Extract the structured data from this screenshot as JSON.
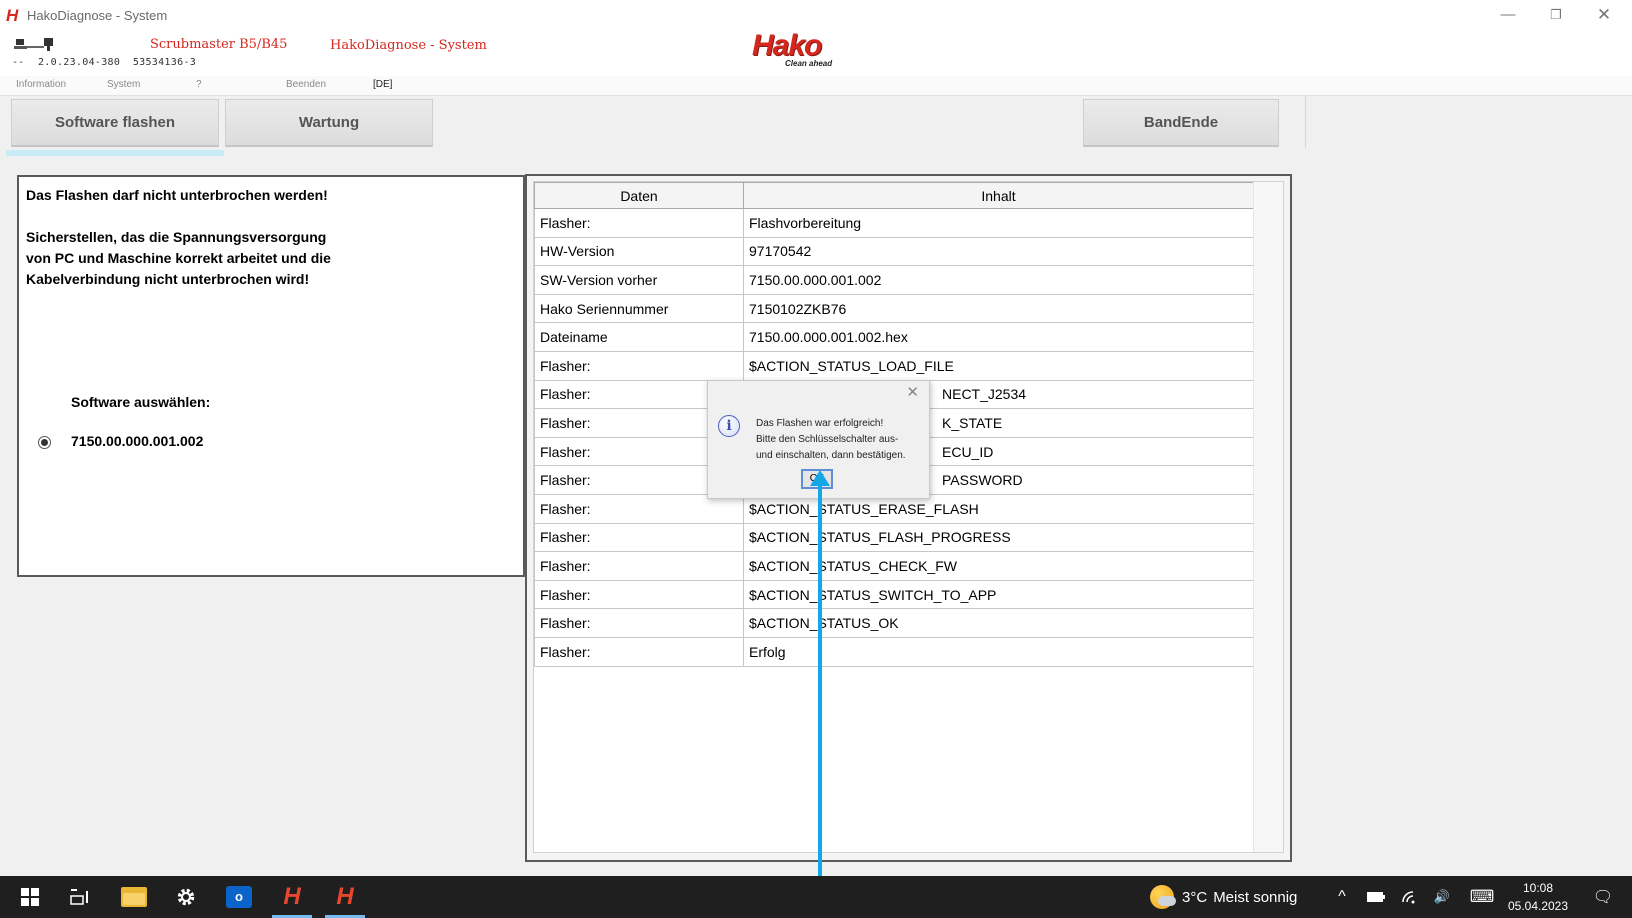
{
  "window": {
    "title": "HakoDiagnose - System",
    "app_icon_glyph": "H",
    "controls": {
      "minimize": "—",
      "maximize": "❐",
      "close": "✕"
    }
  },
  "header": {
    "status_dash": "--",
    "version": "2.0.23.04-380",
    "serial": "53534136-3",
    "machine": "Scrubmaster B5/B45",
    "app_title": "HakoDiagnose - System",
    "brand": "Hako",
    "slogan": "Clean ahead"
  },
  "menu": {
    "items": [
      "Information",
      "System",
      "?",
      "Beenden"
    ],
    "language": "[DE]"
  },
  "toolbar": {
    "flash_label": "Software flashen",
    "wartung_label": "Wartung",
    "bandende_label": "BandEnde"
  },
  "info_panel": {
    "warning": "Das Flashen darf nicht unterbrochen werden!",
    "instructions_lines": [
      "Sicherstellen, das die Spannungsversorgung",
      "von PC und Maschine korrekt arbeitet und die",
      "Kabelverbindung nicht unterbrochen wird!"
    ],
    "select_label": "Software auswählen:",
    "selected_software": "7150.00.000.001.002"
  },
  "table": {
    "columns": [
      "Daten",
      "Inhalt"
    ],
    "rows": [
      [
        "Flasher:",
        "Flashvorbereitung"
      ],
      [
        "HW-Version",
        "97170542"
      ],
      [
        "SW-Version vorher",
        "7150.00.000.001.002"
      ],
      [
        "Hako Seriennummer",
        "7150102ZKB76"
      ],
      [
        "Dateiname",
        "7150.00.000.001.002.hex"
      ],
      [
        "Flasher:",
        "$ACTION_STATUS_LOAD_FILE"
      ],
      [
        "Flasher:",
        "NECT_J2534"
      ],
      [
        "Flasher:",
        "K_STATE"
      ],
      [
        "Flasher:",
        "ECU_ID"
      ],
      [
        "Flasher:",
        "PASSWORD"
      ],
      [
        "Flasher:",
        "$ACTION_STATUS_ERASE_FLASH"
      ],
      [
        "Flasher:",
        "$ACTION_STATUS_FLASH_PROGRESS"
      ],
      [
        "Flasher:",
        "$ACTION_STATUS_CHECK_FW"
      ],
      [
        "Flasher:",
        "$ACTION_STATUS_SWITCH_TO_APP"
      ],
      [
        "Flasher:",
        "$ACTION_STATUS_OK"
      ],
      [
        "Flasher:",
        "Erfolg"
      ]
    ]
  },
  "dialog": {
    "lines": [
      "Das Flashen war erfolgreich!",
      "Bitte den Schlüsselschalter aus-",
      "und einschalten, dann bestätigen."
    ],
    "ok_label": "OK",
    "icon": "info-icon",
    "close_glyph": "✕",
    "info_glyph": "i"
  },
  "taskbar": {
    "weather_temp": "3°C",
    "weather_text": "Meist sonnig",
    "time": "10:08",
    "date": "05.04.2023",
    "hako_glyph": "H",
    "outlook_glyph": "o",
    "tray_glyphs": {
      "chevron": "^",
      "volume": "🔊",
      "keyboard": "⌨",
      "notification": "🗨"
    },
    "colors": {
      "accent": "#76b9ed",
      "hako_red": "#d4281e",
      "pointer": "#14a7e8"
    }
  }
}
